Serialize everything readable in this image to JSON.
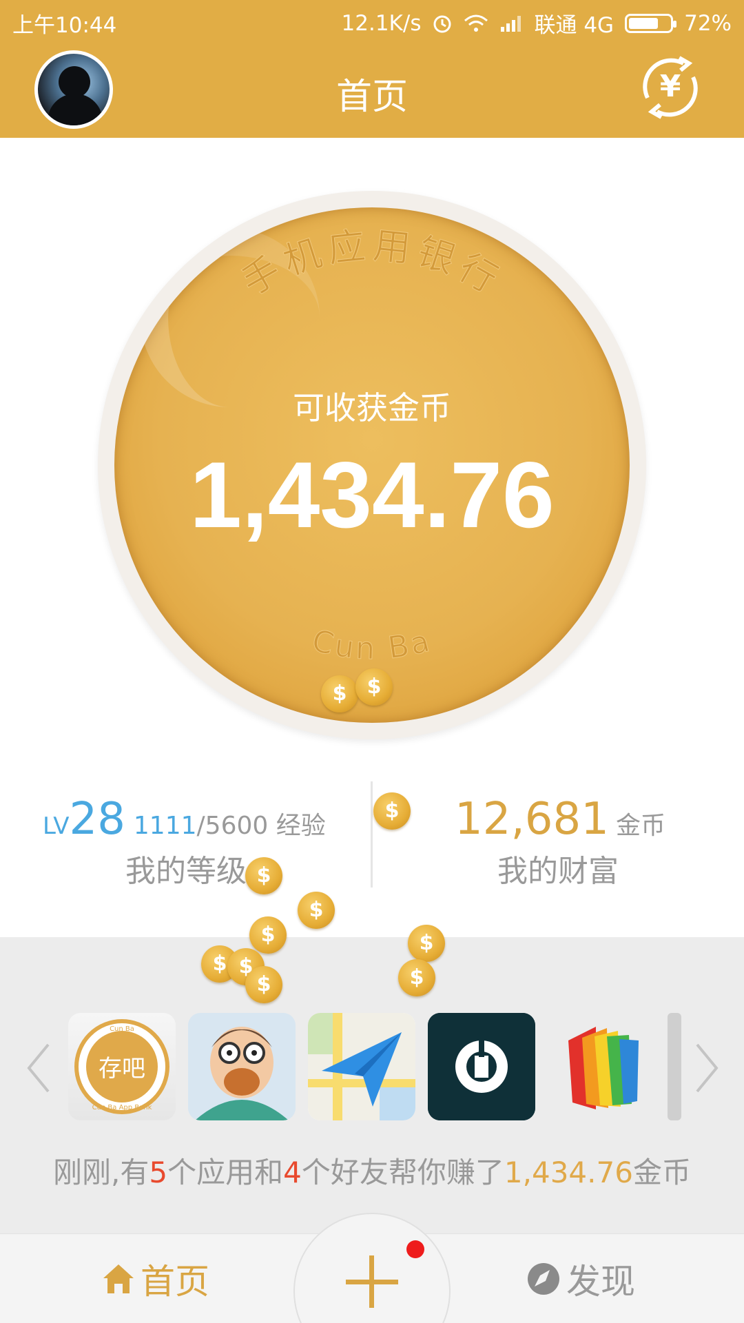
{
  "status_bar": {
    "time": "上午10:44",
    "speed": "12.1K/s",
    "carrier": "联通 4G",
    "battery": "72%",
    "battery_level": 0.72
  },
  "header": {
    "title": "首页",
    "avatar_icon": "user-avatar",
    "right_icon": "yuan-exchange-icon"
  },
  "coin": {
    "engraving": "手机应用银行",
    "brand": "Cun Ba",
    "label": "可收获金币",
    "amount": "1,434.76"
  },
  "stats": {
    "level_prefix": "LV",
    "level": "28",
    "exp_current": "1111",
    "exp_rest": "/5600 经验",
    "level_title": "我的等级",
    "wealth": "12,681",
    "wealth_unit": "金币",
    "wealth_title": "我的财富"
  },
  "apps": [
    {
      "name": "存吧",
      "caption_top": "Cun Ba",
      "caption_bottom": "Cun Ba App Bank"
    },
    {
      "name": "cartoon-app"
    },
    {
      "name": "map-app"
    },
    {
      "name": "uber-app"
    },
    {
      "name": "wallet-app"
    }
  ],
  "summary": {
    "p1": "刚刚,有",
    "apps_count": "5",
    "p2": "个应用和",
    "friends_count": "4",
    "p3": "个好友帮你赚了",
    "amount": "1,434.76",
    "p4": "金币"
  },
  "nav": {
    "home": "首页",
    "discover": "发现",
    "home_icon": "house-icon",
    "discover_icon": "compass-icon",
    "center_icon": "plus-icon"
  },
  "colors": {
    "header": "#e1ad45",
    "accent_gold": "#d9a543",
    "level_blue": "#4aa8e0",
    "highlight_red": "#e84a2e"
  }
}
